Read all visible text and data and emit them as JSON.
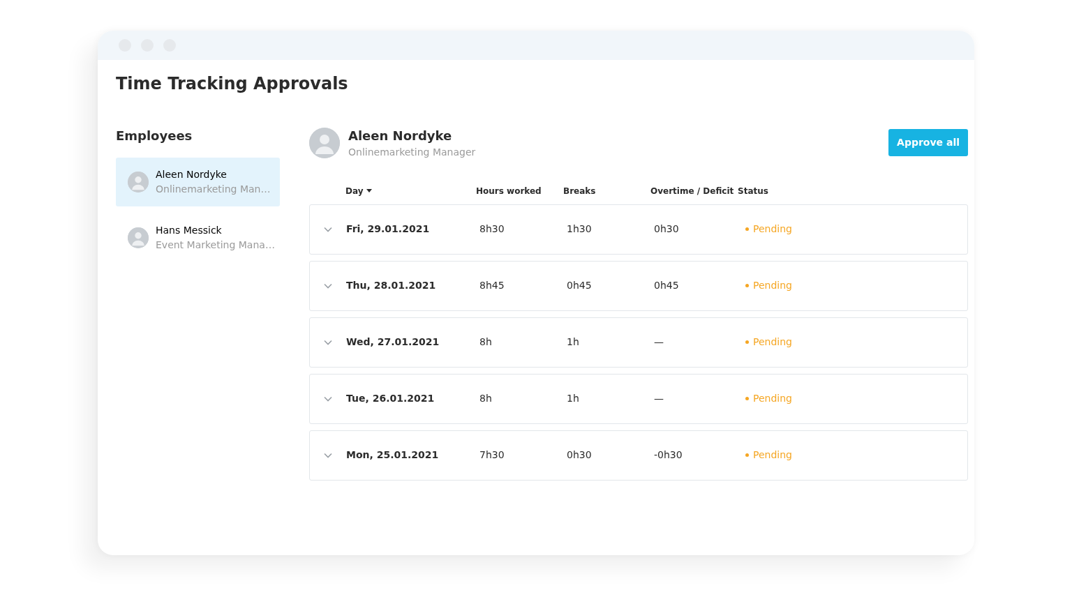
{
  "window": {
    "title": "Time Tracking Approvals"
  },
  "sidebar": {
    "heading": "Employees",
    "items": [
      {
        "name": "Aleen Nordyke",
        "role": "Onlinemarketing Man…",
        "selected": true
      },
      {
        "name": "Hans Messick",
        "role": "Event Marketing Mana…",
        "selected": false
      }
    ]
  },
  "detail": {
    "name": "Aleen Nordyke",
    "role": "Onlinemarketing Manager",
    "approve_button": "Approve all",
    "table": {
      "columns": [
        "Day",
        "Hours worked",
        "Breaks",
        "Overtime / Deficit",
        "Status"
      ],
      "rows": [
        {
          "day": "Fri, 29.01.2021",
          "hours": "8h30",
          "breaks": "1h30",
          "overtime": "0h30",
          "status": "Pending",
          "kind": "pending",
          "expanded": false
        },
        {
          "day": "Thu, 28.01.2021",
          "hours": "8h45",
          "breaks": "0h45",
          "overtime": "0h45",
          "status": "Pending",
          "kind": "pending",
          "expanded": false
        },
        {
          "day": "Wed, 27.01.2021",
          "hours": "8h",
          "breaks": "1h",
          "overtime": "—",
          "status": "Pending",
          "kind": "pending",
          "expanded": false
        },
        {
          "day": "Tue, 26.01.2021",
          "hours": "8h",
          "breaks": "1h",
          "overtime": "—",
          "status": "Pending",
          "kind": "pending",
          "expanded": false
        },
        {
          "day": "Mon, 25.01.2021",
          "hours": "7h30",
          "breaks": "0h30",
          "overtime": "-0h30",
          "status": "Pending",
          "kind": "pending",
          "expanded": false
        }
      ]
    }
  }
}
